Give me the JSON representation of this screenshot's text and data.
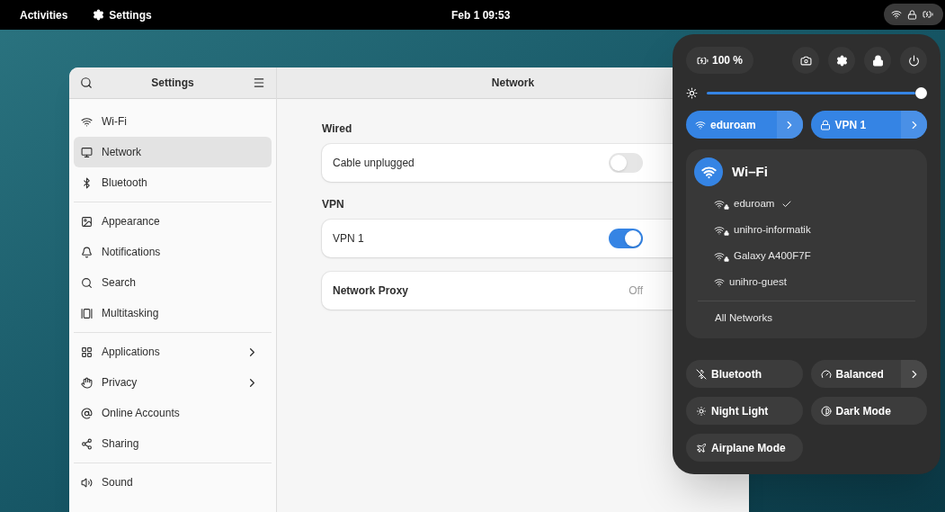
{
  "top_bar": {
    "activities": "Activities",
    "app": "Settings",
    "clock": "Feb 1 09:53"
  },
  "settings_window": {
    "sidebar_title": "Settings",
    "sidebar_groups": [
      {
        "items": [
          {
            "label": "Wi-Fi",
            "selected": false,
            "has_submenu": false
          },
          {
            "label": "Network",
            "selected": true,
            "has_submenu": false
          },
          {
            "label": "Bluetooth",
            "selected": false,
            "has_submenu": false
          }
        ]
      },
      {
        "items": [
          {
            "label": "Appearance",
            "selected": false,
            "has_submenu": false
          },
          {
            "label": "Notifications",
            "selected": false,
            "has_submenu": false
          },
          {
            "label": "Search",
            "selected": false,
            "has_submenu": false
          },
          {
            "label": "Multitasking",
            "selected": false,
            "has_submenu": false
          }
        ]
      },
      {
        "items": [
          {
            "label": "Applications",
            "selected": false,
            "has_submenu": true
          },
          {
            "label": "Privacy",
            "selected": false,
            "has_submenu": true
          },
          {
            "label": "Online Accounts",
            "selected": false,
            "has_submenu": false
          },
          {
            "label": "Sharing",
            "selected": false,
            "has_submenu": false
          }
        ]
      },
      {
        "items": [
          {
            "label": "Sound",
            "selected": false,
            "has_submenu": false
          }
        ]
      }
    ],
    "page_title": "Network",
    "sections": [
      {
        "heading": "Wired",
        "rows": [
          {
            "kind": "switch",
            "label": "Cable unplugged",
            "on": false
          }
        ]
      },
      {
        "heading": "VPN",
        "rows": [
          {
            "kind": "switch",
            "label": "VPN 1",
            "on": true
          }
        ]
      },
      {
        "rows": [
          {
            "kind": "value",
            "label": "Network Proxy",
            "value": "Off"
          }
        ]
      }
    ]
  },
  "quick_settings": {
    "battery": "100 %",
    "brightness": {
      "level": 1.0
    },
    "pills": [
      {
        "label": "eduroam",
        "on": true
      },
      {
        "label": "VPN 1",
        "on": true
      }
    ],
    "wifi_menu": {
      "title": "Wi–Fi",
      "on": true,
      "networks": [
        {
          "name": "eduroam",
          "secured": true,
          "connected": true
        },
        {
          "name": "unihro-informatik",
          "secured": true,
          "connected": false
        },
        {
          "name": "Galaxy A400F7F",
          "secured": true,
          "connected": false
        },
        {
          "name": "unihro-guest",
          "secured": false,
          "connected": false
        }
      ],
      "footer": "All Networks"
    },
    "toggles": [
      {
        "label": "Bluetooth",
        "on": false,
        "has_menu": false
      },
      {
        "label": "Balanced",
        "on": false,
        "has_menu": true
      },
      {
        "label": "Night Light",
        "on": false,
        "has_menu": false
      },
      {
        "label": "Dark Mode",
        "on": false,
        "has_menu": false
      },
      {
        "label": "Airplane Mode",
        "on": false,
        "has_menu": false
      }
    ]
  }
}
